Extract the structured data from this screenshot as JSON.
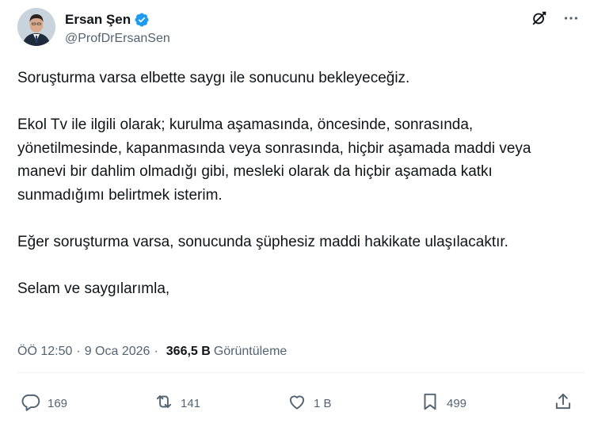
{
  "author": {
    "display_name": "Ersan Şen",
    "handle": "@ProfDrErsanSen",
    "verified_color": "#1d9bf0"
  },
  "icons": {
    "verified": "verified-badge-icon",
    "grok": "grok-icon",
    "more": "more-options-icon",
    "reply": "reply-icon",
    "repost": "repost-icon",
    "like": "like-icon",
    "bookmark": "bookmark-icon",
    "share": "share-icon"
  },
  "tweet": {
    "paragraphs": [
      "Soruşturma varsa elbette saygı ile sonucunu bekleyeceğiz.",
      "Ekol Tv ile ilgili olarak; kurulma aşamasında, öncesinde, sonrasında, yönetilmesinde, kapanmasında veya sonrasında, hiçbir aşamada maddi veya manevi bir dahlim olmadığı gibi, mesleki olarak da hiçbir aşamada katkı sunmadığımı belirtmek isterim.",
      "Eğer soruşturma varsa, sonucunda şüphesiz maddi hakikate ulaşılacaktır.",
      "Selam ve saygılarımla,"
    ]
  },
  "meta": {
    "time": "ÖÖ 12:50",
    "date": "9 Oca 2026",
    "separator": "·",
    "views_count": "366,5 B",
    "views_label": "Görüntüleme"
  },
  "actions": {
    "replies": "169",
    "reposts": "141",
    "likes": "1 B",
    "bookmarks": "499"
  }
}
